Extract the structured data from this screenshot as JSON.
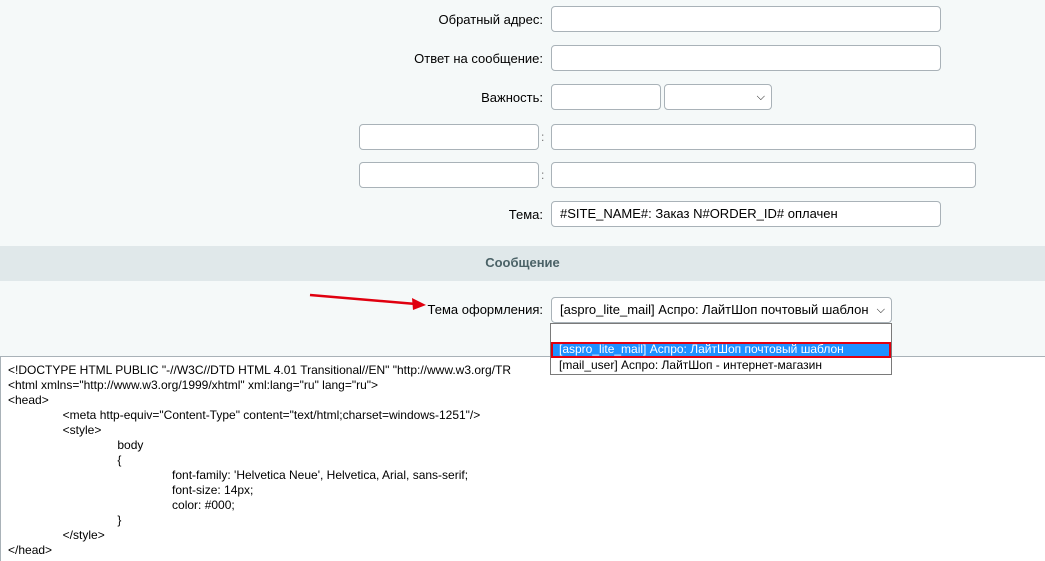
{
  "form": {
    "return_address_label": "Обратный адрес:",
    "return_address_value": "",
    "reply_to_label": "Ответ на сообщение:",
    "reply_to_value": "",
    "importance_label": "Важность:",
    "importance_value": "",
    "importance_select_value": "",
    "extra1_name": "",
    "extra1_value": "",
    "extra2_name": "",
    "extra2_value": "",
    "colon": ":",
    "subject_label": "Тема:",
    "subject_value": "#SITE_NAME#: Заказ N#ORDER_ID# оплачен"
  },
  "section": {
    "title": "Сообщение"
  },
  "theme": {
    "label": "Тема оформления:",
    "selected": "[aspro_lite_mail] Аспро: ЛайтШоп почтовый шаблон",
    "options": [
      "",
      "[aspro_lite_mail] Аспро: ЛайтШоп почтовый шаблон",
      "[mail_user] Аспро: ЛайтШоп - интернет-магазин"
    ]
  },
  "editor": {
    "lines": [
      "<!DOCTYPE HTML PUBLIC \"-//W3C//DTD HTML 4.01 Transitional//EN\" \"http://www.w3.org/TR",
      "<html xmlns=\"http://www.w3.org/1999/xhtml\" xml:lang=\"ru\" lang=\"ru\">",
      "<head>",
      "\t<meta http-equiv=\"Content-Type\" content=\"text/html;charset=windows-1251\"/>",
      "\t<style>",
      "\t\tbody",
      "\t\t{",
      "\t\t\tfont-family: 'Helvetica Neue', Helvetica, Arial, sans-serif;",
      "\t\t\tfont-size: 14px;",
      "\t\t\tcolor: #000;",
      "\t\t}",
      "\t</style>",
      "</head>"
    ]
  },
  "colors": {
    "annotation_red": "#e0000f",
    "selected_option_bg": "#1e90ff",
    "section_bg": "#e0e8ea"
  }
}
